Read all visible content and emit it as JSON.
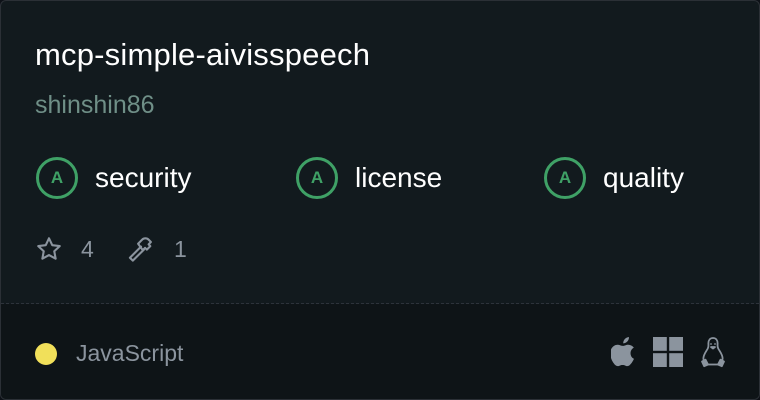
{
  "repo": {
    "name": "mcp-simple-aivisspeech",
    "owner": "shinshin86"
  },
  "grades": [
    {
      "grade": "A",
      "label": "security"
    },
    {
      "grade": "A",
      "label": "license"
    },
    {
      "grade": "A",
      "label": "quality"
    }
  ],
  "stats": {
    "stars": "4",
    "tools": "1"
  },
  "footer": {
    "language": "JavaScript",
    "language_color": "#f1e05a",
    "platform_icons": [
      "apple-icon",
      "windows-icon",
      "linux-icon"
    ]
  },
  "colors": {
    "grade_accent": "#3fa166",
    "background": "#121a1e"
  }
}
